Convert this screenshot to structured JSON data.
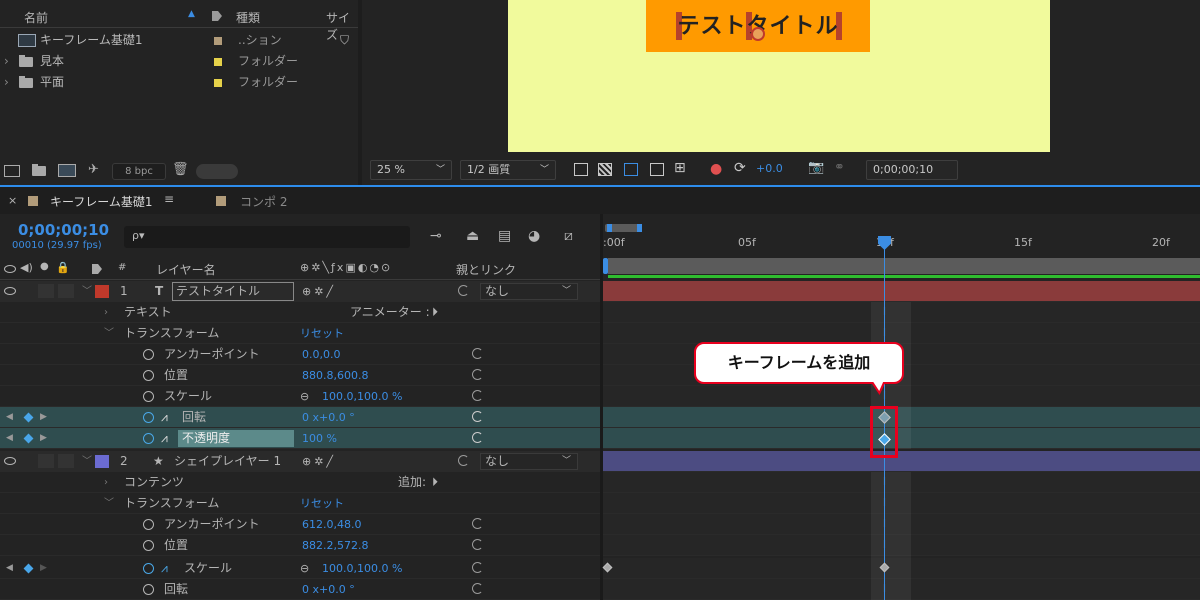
{
  "project": {
    "col_name": "名前",
    "col_type": "種類",
    "col_size": "サイズ",
    "items": [
      {
        "name": "キーフレーム基礎1",
        "type": "..ション",
        "color": "#b29c7a"
      },
      {
        "name": "見本",
        "type": "フォルダー",
        "color": "#e6d24a"
      },
      {
        "name": "平面",
        "type": "フォルダー",
        "color": "#e6d24a"
      }
    ],
    "bpc": "8 bpc"
  },
  "viewer": {
    "comp_text": "テストタイトル",
    "zoom": "25 %",
    "resolution": "1/2 画質",
    "exposure": "+0.0",
    "timecode": "0;00;00;10"
  },
  "timeline": {
    "tabs": [
      {
        "label": "キーフレーム基礎1",
        "color": "#b29c7a"
      },
      {
        "label": "コンポ 2",
        "color": "#b29c7a"
      }
    ],
    "current_time": "0;00;00;10",
    "frames": "00010 (29.97 fps)",
    "search_placeholder": "ρ▾",
    "col_layer_name": "レイヤー名",
    "col_parent": "親とリンク",
    "ruler_ticks": [
      ":00f",
      "05f",
      "10f",
      "15f",
      "20f"
    ],
    "rows": [
      {
        "kind": "layer",
        "num": "1",
        "type_icon": "T",
        "name": "テストタイトル",
        "color": "#c0392b",
        "parent": "なし"
      },
      {
        "kind": "group",
        "name": "テキスト",
        "extra": "アニメーター :"
      },
      {
        "kind": "group",
        "name": "トランスフォーム",
        "extra": "リセット"
      },
      {
        "kind": "prop",
        "name": "アンカーポイント",
        "value": "0.0,0.0"
      },
      {
        "kind": "prop",
        "name": "位置",
        "value": "880.8,600.8"
      },
      {
        "kind": "prop",
        "name": "スケール",
        "value": "100.0,100.0 %"
      },
      {
        "kind": "prop-kf",
        "name": "回転",
        "value": "0 x+0.0 °"
      },
      {
        "kind": "prop-kf",
        "name": "不透明度",
        "value": "100 %"
      },
      {
        "kind": "layer",
        "num": "2",
        "type_icon": "★",
        "name": "シェイプレイヤー 1",
        "color": "#6b6bd1",
        "parent": "なし"
      },
      {
        "kind": "group",
        "name": "コンテンツ",
        "extra": "追加:"
      },
      {
        "kind": "group",
        "name": "トランスフォーム",
        "extra": "リセット"
      },
      {
        "kind": "prop",
        "name": "アンカーポイント",
        "value": "612.0,48.0"
      },
      {
        "kind": "prop",
        "name": "位置",
        "value": "882.2,572.8"
      },
      {
        "kind": "prop-kf",
        "name": "スケール",
        "value": "100.0,100.0 %"
      },
      {
        "kind": "prop",
        "name": "回転",
        "value": "0 x+0.0 °"
      }
    ]
  },
  "callout": {
    "text": "キーフレームを追加"
  }
}
